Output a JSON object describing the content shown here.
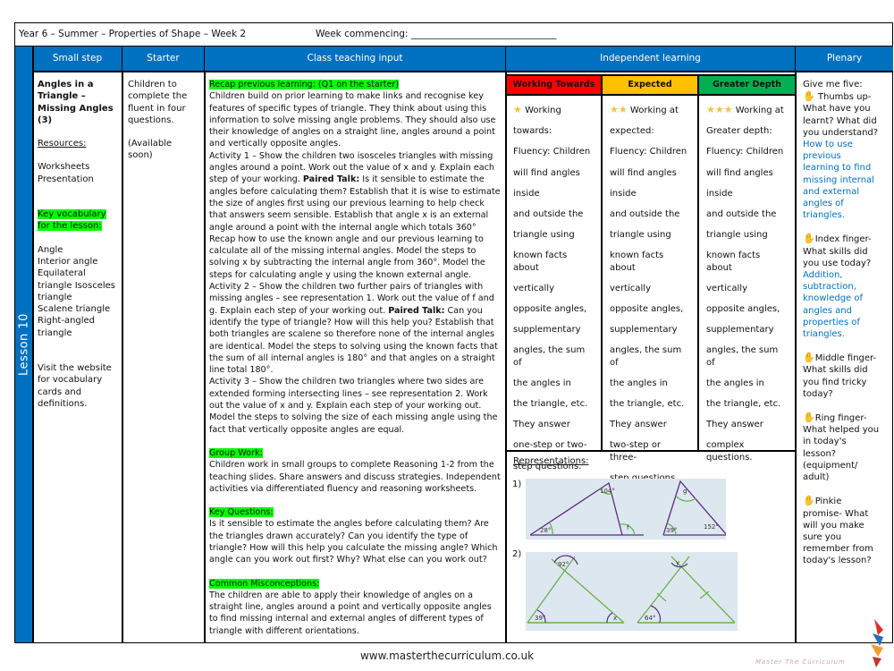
{
  "header": {
    "title": "Year 6 – Summer – Properties of Shape – Week 2",
    "week_commencing_label": "Week commencing: _______________________________"
  },
  "lesson_label": "Lesson 10",
  "columns": {
    "small_step": "Small step",
    "starter": "Starter",
    "class_teaching_input": "Class teaching input",
    "independent_learning": "Independent learning",
    "plenary": "Plenary"
  },
  "small_step": {
    "title_lines": [
      "Angles in a",
      "Triangle –",
      "Missing Angles",
      "(3)"
    ],
    "resources_label": "Resources:",
    "resources": [
      "Worksheets",
      "Presentation"
    ],
    "vocab_label_lines": [
      "Key vocabulary",
      "for the lesson:"
    ],
    "vocab_lines": [
      "Angle",
      "Interior angle",
      "Equilateral",
      "triangle Isosceles",
      "triangle",
      "Scalene triangle",
      "Right-angled",
      "triangle"
    ],
    "website_lines": [
      "Visit the website",
      "for vocabulary",
      "cards and",
      "definitions."
    ]
  },
  "starter": {
    "lines": [
      "Children to",
      "complete the",
      "fluent in four",
      "questions."
    ],
    "availability_lines": [
      "(Available",
      "soon)"
    ]
  },
  "teaching": {
    "recap_heading": "Recap previous learning: (Q1 on the starter)",
    "recap_text": "Children build on prior learning to make links and recognise key features of specific types of triangle. They think about using this information to solve missing angle problems. They should also use their knowledge of angles on a straight line, angles around a point and vertically opposite angles.",
    "activity1_a": "Activity 1 – Show the children two isosceles triangles with missing angles around a point. Work out the value of x and y. Explain each step of your working.",
    "paired_talk_label": "Paired Talk:",
    "activity1_b": "Is it sensible to estimate the angles before calculating them? Establish that it is wise to estimate the size of angles first using our previous learning to help check that answers seem sensible. Establish that angle x is an external angle around a point with the internal angle which totals 360° Recap how to use the known angle and our previous learning to calculate all of the missing internal angles. Model the steps to solving x by subtracting the internal angle from 360°. Model the steps for calculating angle y using the known external angle.",
    "activity2_a": "Activity 2 – Show the children two further pairs of triangles with missing angles – see representation 1. Work out the value of f and g. Explain each step of your working out.",
    "activity2_b": "Can you identify the type of triangle? How will this help you? Establish that both triangles are scalene so therefore none of the internal angles are identical. Model the steps to solving using the known facts that the sum of all internal angles is 180° and that angles on a straight line total 180°.",
    "activity3": "Activity 3 – Show the children two triangles where two sides are extended forming intersecting lines – see representation 2. Work out the value of x and y. Explain each step of your working out. Model the steps to solving the size of each missing angle using the fact that vertically opposite angles are equal.",
    "group_work_heading": "Group Work:",
    "group_work_text": "Children work in small groups to complete Reasoning 1-2 from the teaching slides. Share answers and discuss strategies. Independent activities via differentiated fluency and reasoning worksheets.",
    "key_questions_heading": "Key Questions:",
    "key_questions_text": "Is it sensible to estimate the angles before calculating them? Are the triangles drawn accurately? Can you identify the type of triangle? How will this help you calculate the missing angle? Which angle can you work out first? Why? What else can you work out?",
    "misconceptions_heading": "Common Misconceptions:",
    "misconceptions_text": "The children are able to apply their knowledge of angles on a straight line, angles around a point and vertically opposite angles to find missing internal and external angles of different types of triangle with different orientations."
  },
  "independent": {
    "levels": [
      {
        "label": "Working Towards",
        "color": "#ff0000",
        "stars": 1,
        "lines": [
          "Working",
          "towards:",
          "Fluency: Children",
          "will find angles",
          "inside",
          "and outside the",
          "triangle using",
          "known facts about",
          "vertically",
          "opposite angles,",
          "supplementary",
          "angles, the sum of",
          "the angles in",
          "the triangle, etc.",
          "They answer",
          "one-step or two-",
          "step questions."
        ]
      },
      {
        "label": "Expected",
        "color": "#ffc000",
        "stars": 2,
        "lines": [
          "Working at",
          "expected:",
          "Fluency: Children",
          "will find angles",
          "inside",
          "and outside the",
          "triangle using",
          "known facts about",
          "vertically",
          "opposite angles,",
          "supplementary",
          "angles, the sum of",
          "the angles in",
          "the triangle, etc.",
          "They answer",
          "two-step or three-",
          "step questions."
        ]
      },
      {
        "label": "Greater Depth",
        "color": "#00b050",
        "stars": 3,
        "lines": [
          "Working at",
          "Greater depth:",
          "Fluency: Children",
          "will find angles",
          "inside",
          "and outside the",
          "triangle using",
          "known facts about",
          "vertically",
          "opposite angles,",
          "supplementary",
          "angles, the sum of",
          "the angles in",
          "the triangle, etc.",
          "They answer",
          "complex questions."
        ]
      }
    ],
    "representations_label": "Representations:",
    "rep1_label": "1)",
    "rep2_label": "2)",
    "rep1_angles": {
      "a": "104°",
      "b": "28°",
      "c": "f",
      "d": "g",
      "e": "39°",
      "f": "152°"
    },
    "rep2_angles": {
      "a": "92°",
      "b": "39°",
      "c": "x",
      "d": "y",
      "e": "64°"
    }
  },
  "plenary": {
    "intro": "Give me five:",
    "thumb_q": [
      "Thumbs up-",
      "What have you",
      "learnt? What did",
      "you understand?"
    ],
    "thumb_a": [
      "How to use",
      "previous",
      "learning to find",
      "missing internal",
      "and external",
      "angles of",
      "triangles."
    ],
    "index_q": [
      "Index finger-",
      "What skills did",
      "you use today?"
    ],
    "index_a": [
      "Addition,",
      "subtraction,",
      "knowledge of",
      "angles and",
      "properties of",
      "triangles."
    ],
    "middle_q": [
      "Middle finger-",
      "What skills did",
      "you find tricky",
      "today?"
    ],
    "ring_q": [
      "Ring finger-",
      "What helped you",
      "in today's",
      "lesson?",
      "(equipment/",
      "adult)"
    ],
    "pinkie_q": [
      "Pinkie",
      "promise- What",
      "will you make",
      "sure you",
      "remember from",
      "today's lesson?"
    ]
  },
  "footer": {
    "url": "www.masterthecurriculum.co.uk",
    "logo_text": "Master The Curriculum"
  }
}
